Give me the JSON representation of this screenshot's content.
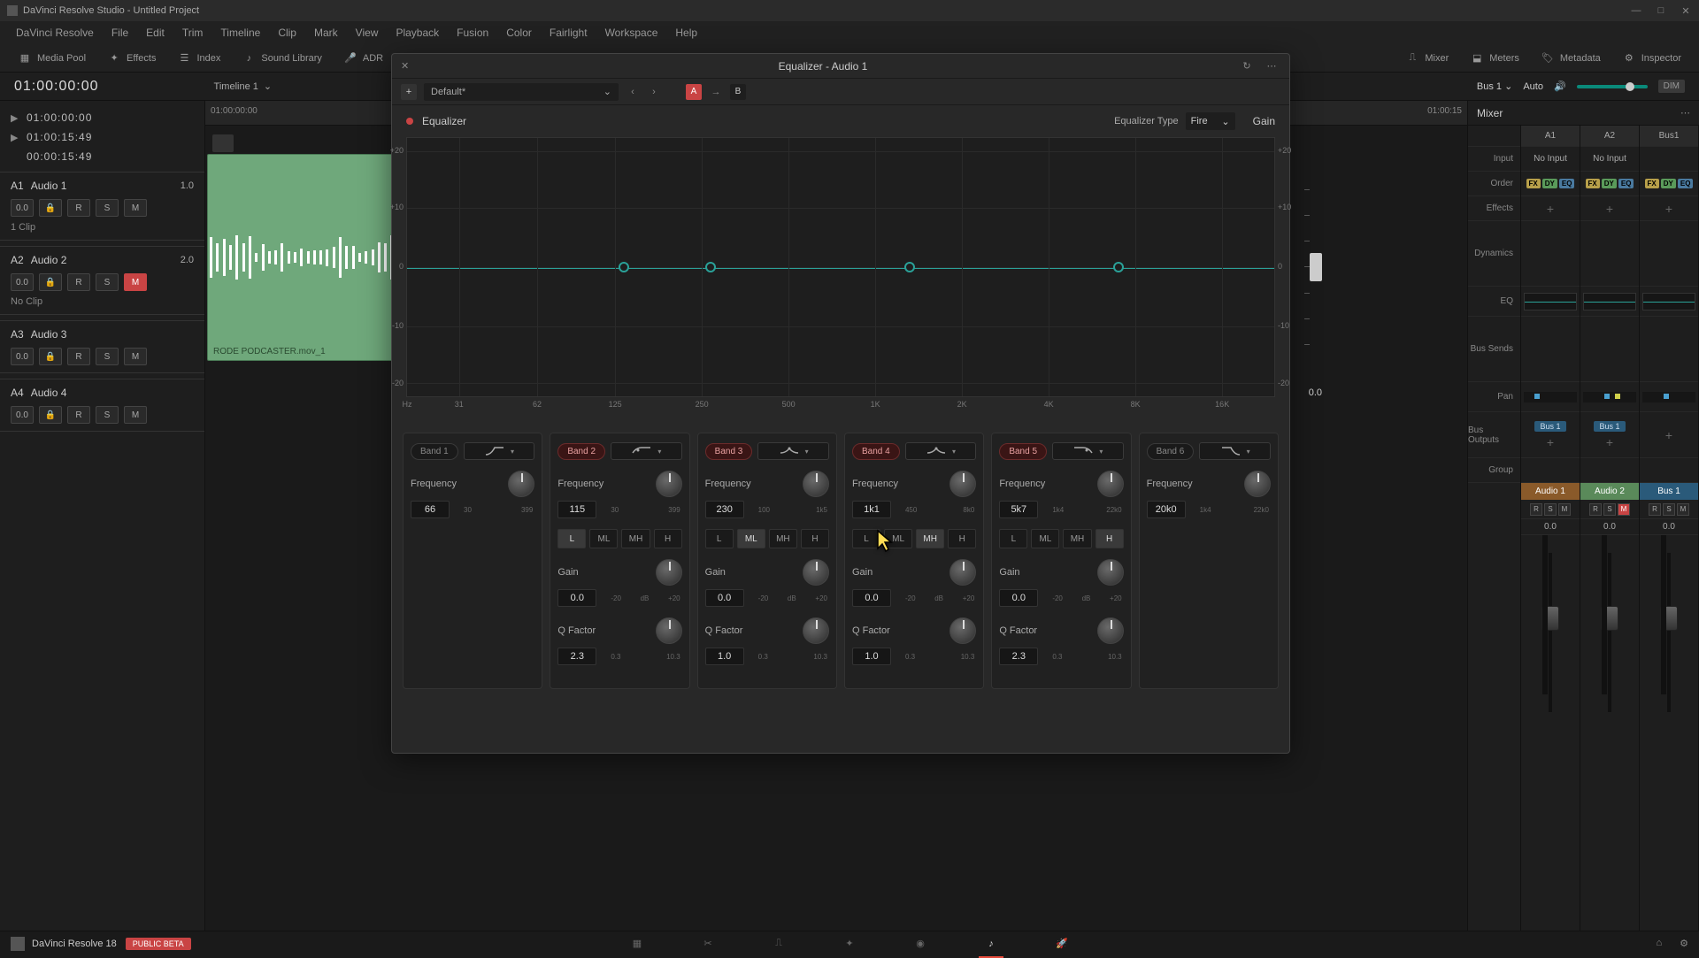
{
  "title": "DaVinci Resolve Studio - Untitled Project",
  "menu": [
    "DaVinci Resolve",
    "File",
    "Edit",
    "Trim",
    "Timeline",
    "Clip",
    "Mark",
    "View",
    "Playback",
    "Fusion",
    "Color",
    "Fairlight",
    "Workspace",
    "Help"
  ],
  "toolbar": {
    "mediaPool": "Media Pool",
    "effects": "Effects",
    "index": "Index",
    "soundLibrary": "Sound Library",
    "adr": "ADR",
    "project": "Untitled Project",
    "mixer": "Mixer",
    "meters": "Meters",
    "metadata": "Metadata",
    "inspector": "Inspector"
  },
  "secondbar": {
    "timecode": "01:00:00:00",
    "timeline": "Timeline 1",
    "bus": "Bus 1",
    "auto": "Auto",
    "dim": "DIM"
  },
  "leftpanel": {
    "tc1": "01:00:00:00",
    "tc2": "01:00:15:49",
    "tc3": "00:00:15:49",
    "tracks": [
      {
        "id": "A1",
        "name": "Audio 1",
        "val": "1.0",
        "vol": "0.0",
        "clip": "1 Clip"
      },
      {
        "id": "A2",
        "name": "Audio 2",
        "val": "2.0",
        "vol": "0.0",
        "clip": "No Clip",
        "mute": true
      },
      {
        "id": "A3",
        "name": "Audio 3",
        "val": "",
        "vol": "0.0"
      },
      {
        "id": "A4",
        "name": "Audio 4",
        "val": "",
        "vol": "0.0"
      }
    ]
  },
  "ruler": {
    "start": "01:00:00:00",
    "end": "01:00:15"
  },
  "clipName": "RODE PODCASTER.mov_1",
  "eq": {
    "title": "Equalizer - Audio 1",
    "preset": "Default*",
    "name": "Equalizer",
    "typeLabel": "Equalizer Type",
    "type": "Fire",
    "gainLabel": "Gain",
    "gainVal": "0.0",
    "yticks": [
      "+20",
      "+10",
      "0",
      "-10",
      "-20"
    ],
    "xticks": [
      "Hz",
      "31",
      "62",
      "125",
      "250",
      "500",
      "1K",
      "2K",
      "4K",
      "8K",
      "16K"
    ],
    "bands": [
      {
        "label": "Band 1",
        "on": false,
        "shape": "hp",
        "freq": "66",
        "fmin": "30",
        "fmax": "399"
      },
      {
        "label": "Band 2",
        "on": true,
        "shape": "ls",
        "freq": "115",
        "fmin": "30",
        "fmax": "399",
        "lmh": [
          "L",
          "ML",
          "MH",
          "H"
        ],
        "lmhActive": 0,
        "gain": "0.0",
        "gmin": "-20",
        "gzero": "dB",
        "gmax": "+20",
        "q": "2.3",
        "qmin": "0.3",
        "qmax": "10.3"
      },
      {
        "label": "Band 3",
        "on": true,
        "shape": "bell",
        "freq": "230",
        "fmin": "100",
        "fmax": "1k5",
        "lmh": [
          "L",
          "ML",
          "MH",
          "H"
        ],
        "lmhActive": 1,
        "gain": "0.0",
        "gmin": "-20",
        "gzero": "dB",
        "gmax": "+20",
        "q": "1.0",
        "qmin": "0.3",
        "qmax": "10.3"
      },
      {
        "label": "Band 4",
        "on": true,
        "shape": "bell",
        "freq": "1k1",
        "fmin": "450",
        "fmax": "8k0",
        "lmh": [
          "L",
          "ML",
          "MH",
          "H"
        ],
        "lmhActive": 2,
        "gain": "0.0",
        "gmin": "-20",
        "gzero": "dB",
        "gmax": "+20",
        "q": "1.0",
        "qmin": "0.3",
        "qmax": "10.3"
      },
      {
        "label": "Band 5",
        "on": true,
        "shape": "hs",
        "freq": "5k7",
        "fmin": "1k4",
        "fmax": "22k0",
        "lmh": [
          "L",
          "ML",
          "MH",
          "H"
        ],
        "lmhActive": 3,
        "gain": "0.0",
        "gmin": "-20",
        "gzero": "dB",
        "gmax": "+20",
        "q": "2.3",
        "qmin": "0.3",
        "qmax": "10.3"
      },
      {
        "label": "Band 6",
        "on": false,
        "shape": "lp",
        "freq": "20k0",
        "fmin": "1k4",
        "fmax": "22k0"
      }
    ],
    "freqLabel": "Frequency",
    "gainParamLabel": "Gain",
    "qLabel": "Q Factor"
  },
  "mixer": {
    "title": "Mixer",
    "labels": [
      "",
      "Input",
      "Order",
      "Effects",
      "Dynamics",
      "EQ",
      "Bus Sends",
      "Pan",
      "Bus Outputs",
      "Group"
    ],
    "cols": [
      {
        "head": "A1",
        "input": "No Input",
        "bus": "Bus 1",
        "footer": "Audio 1",
        "footClass": "",
        "db": "0.0",
        "mute": false
      },
      {
        "head": "A2",
        "input": "No Input",
        "bus": "Bus 1",
        "footer": "Audio 2",
        "footClass": "a2",
        "db": "0.0",
        "mute": true
      },
      {
        "head": "Bus1",
        "input": "",
        "bus": "",
        "footer": "Bus 1",
        "footClass": "bus",
        "db": "0.0",
        "mute": false
      }
    ]
  },
  "bottombar": {
    "app": "DaVinci Resolve 18",
    "badge": "PUBLIC BETA"
  }
}
